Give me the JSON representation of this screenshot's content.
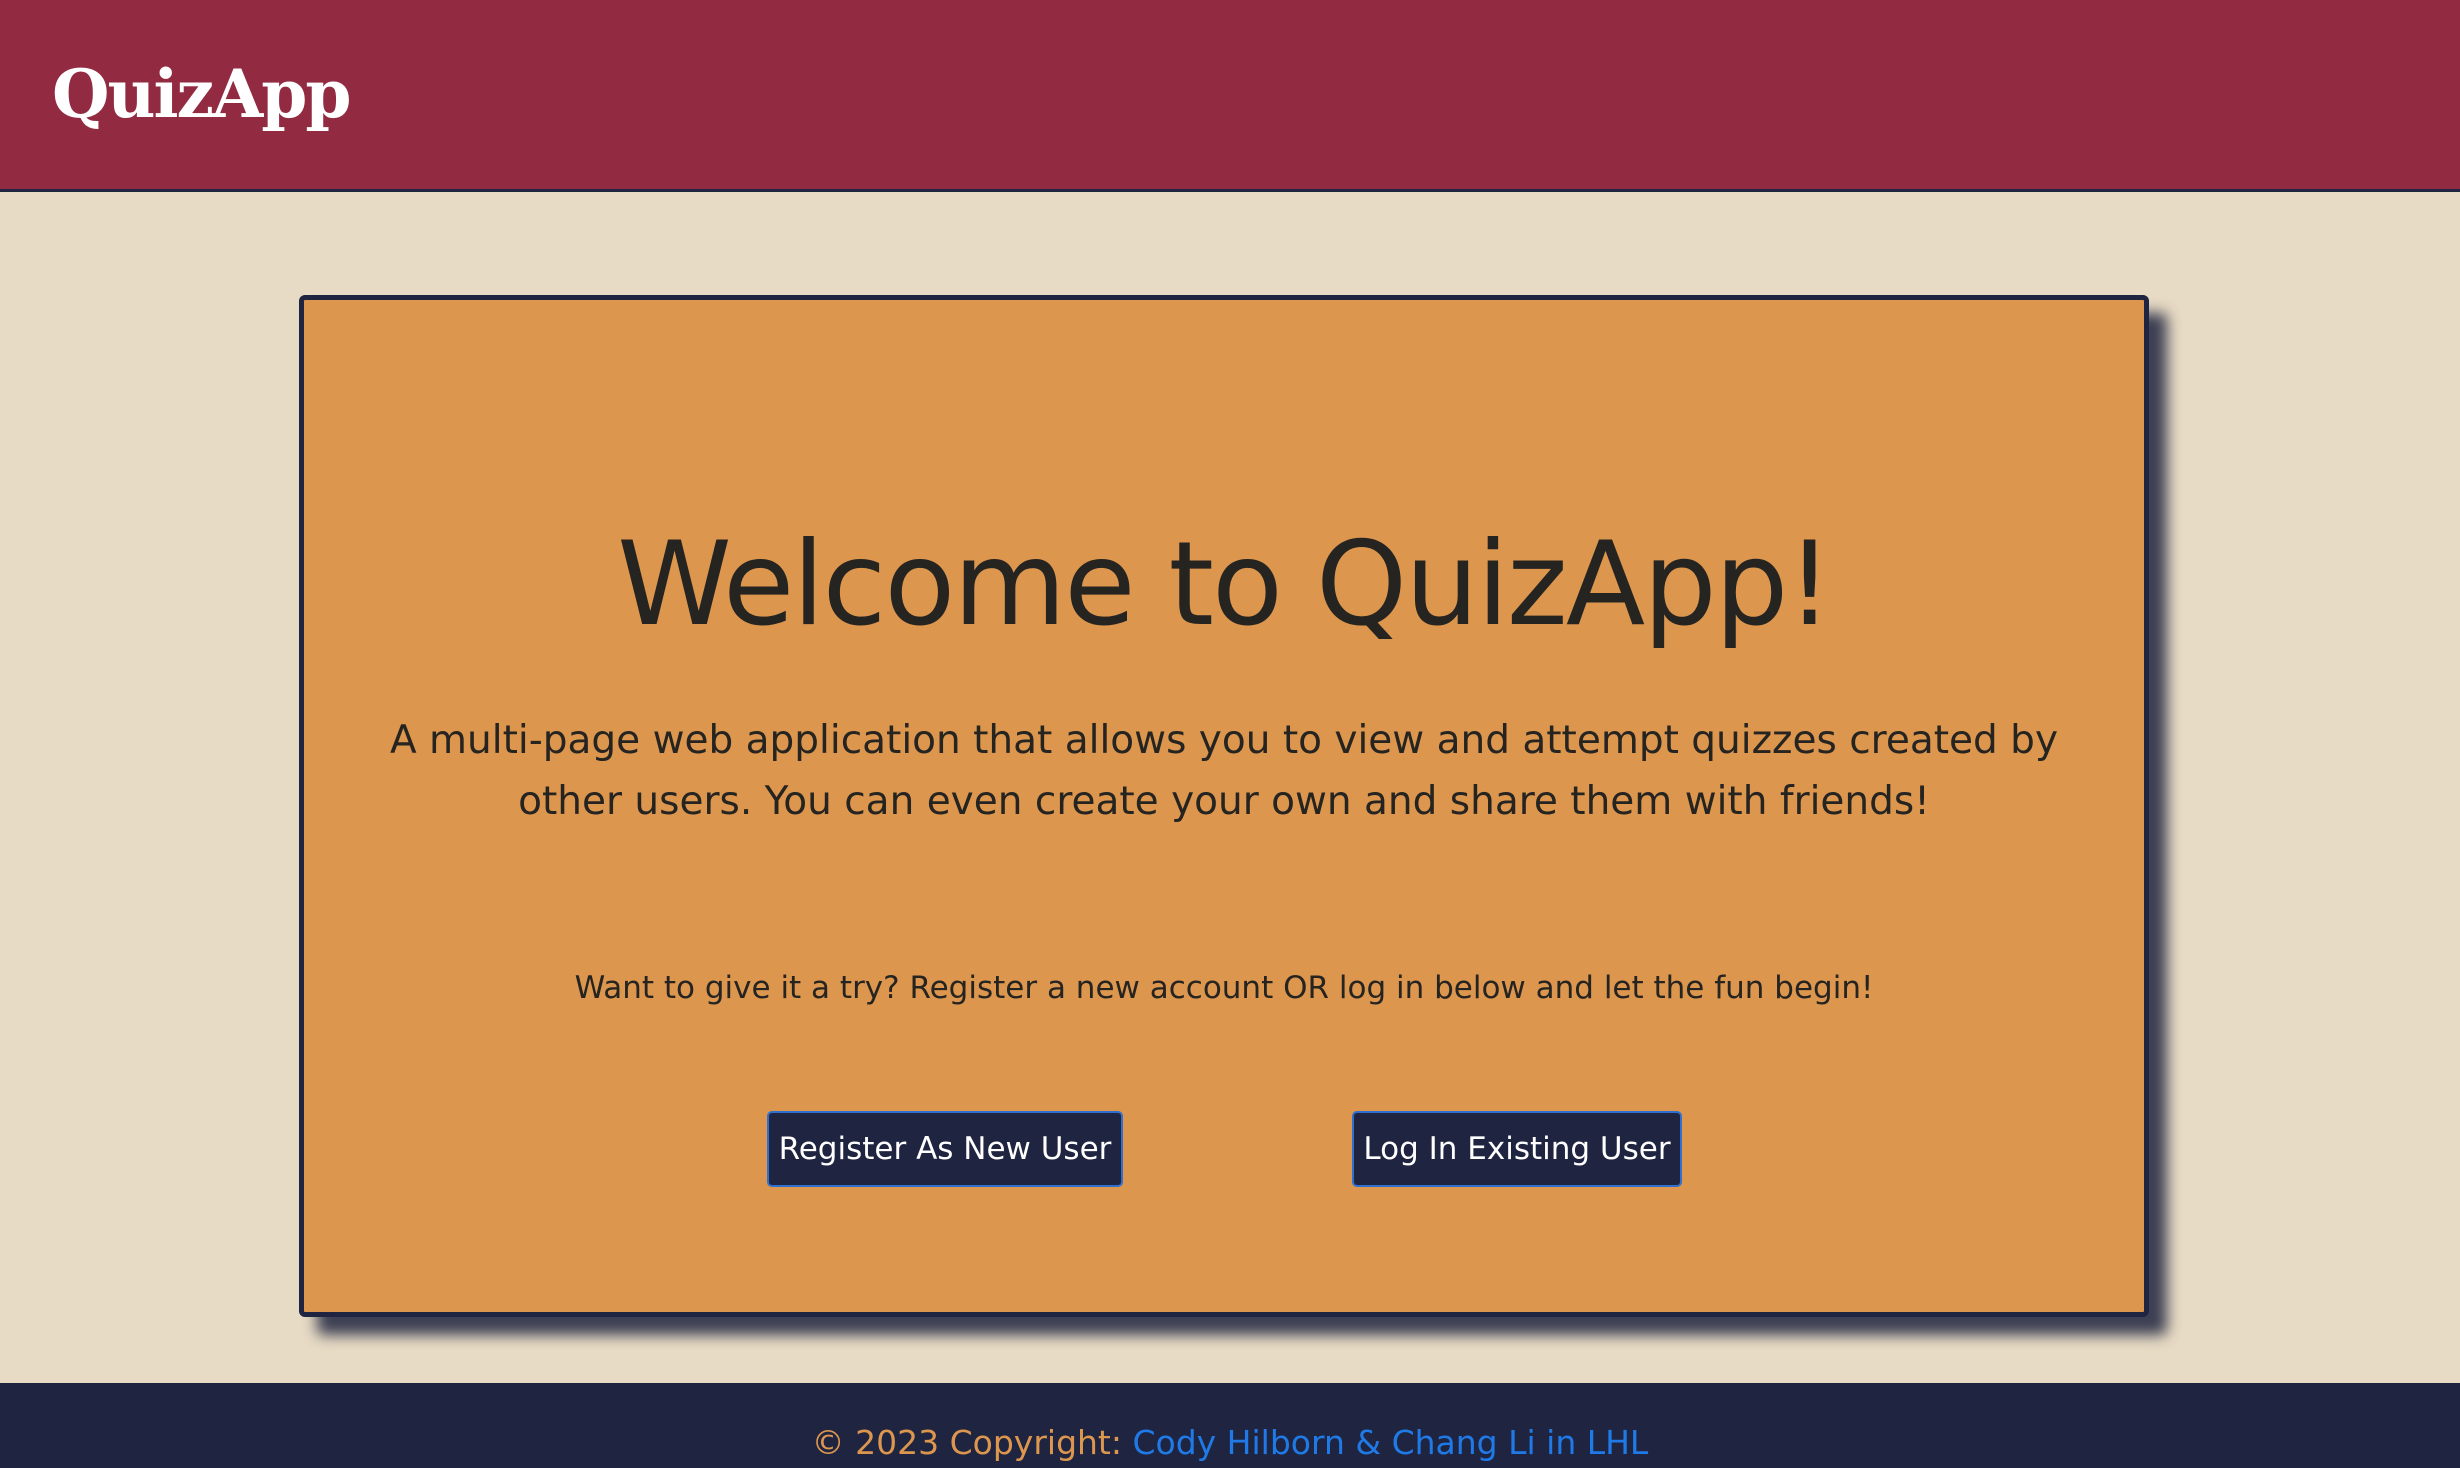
{
  "navbar": {
    "brand": "QuizApp",
    "background_color": "#922a41"
  },
  "hero": {
    "title": "Welcome to QuizApp!",
    "description": "A multi-page web application that allows you to view and attempt quizzes created by other users. You can even create your own and share them with friends!",
    "prompt": "Want to give it a try? Register a new account OR log in below and let the fun begin!",
    "card_color": "#dc964e"
  },
  "actions": {
    "register_label": "Register As New User",
    "login_label": "Log In Existing User",
    "button_color": "#1f2440"
  },
  "footer": {
    "copyright": "© 2023 Copyright: ",
    "credit_link": "Cody Hilborn & Chang Li in LHL",
    "link_color": "#1f7ae8"
  },
  "page": {
    "background_color": "#e8dbc5"
  }
}
